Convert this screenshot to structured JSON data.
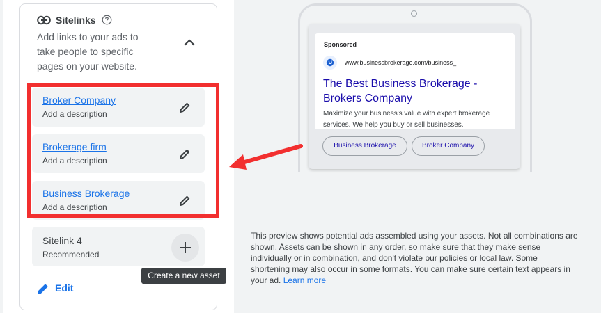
{
  "panel": {
    "title": "Sitelinks",
    "description": "Add links to your ads to take people to specific pages on your website.",
    "sitelinks": [
      {
        "name": "Broker Company",
        "description": "Add a description"
      },
      {
        "name": "Brokerage firm",
        "description": "Add a description"
      },
      {
        "name": "Business Brokerage",
        "description": "Add a description"
      }
    ],
    "sitelink4": {
      "title": "Sitelink 4",
      "subtitle": "Recommended"
    },
    "tooltip": "Create a new asset",
    "edit_label": "Edit"
  },
  "preview": {
    "sponsored": "Sponsored",
    "url": "www.businessbrokerage.com/business_",
    "headline": "The Best Business Brokerage - Brokers Company",
    "description": "Maximize your business's value with expert brokerage services. We help you buy or sell businesses.",
    "chips": [
      "Business Brokerage",
      "Broker Company"
    ],
    "note": "This preview shows potential ads assembled using your assets. Not all combinations are shown. Assets can be shown in any order, so make sure that they make sense individually or in combination, and don't violate our policies or local law. Some shortening may also occur in some formats. You can make sure certain text appears in your ad.",
    "learn_more": "Learn more"
  },
  "colors": {
    "accent": "#1a73e8",
    "highlight": "#f22f2f",
    "ad_headline": "#1a0dab"
  },
  "icons": [
    "link-icon",
    "help-icon",
    "chevron-up-icon",
    "pencil-icon",
    "plus-icon",
    "globe-icon",
    "arrow-left-icon"
  ]
}
